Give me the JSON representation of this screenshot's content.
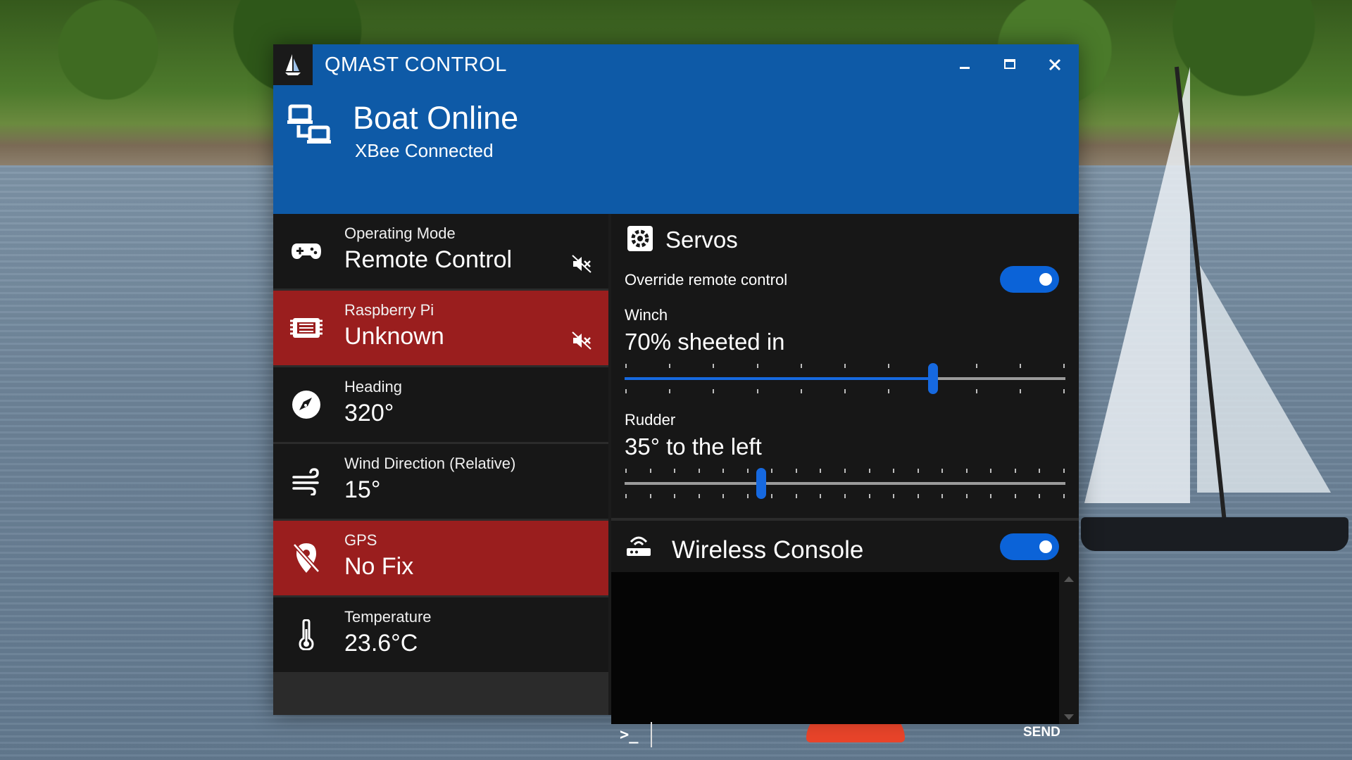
{
  "window": {
    "title": "QMAST CONTROL",
    "controls": {
      "minimize": "minimize-icon",
      "maximize": "maximize-icon",
      "close": "close-icon"
    }
  },
  "status": {
    "title": "Boat Online",
    "subtitle": "XBee Connected",
    "icon": "network-icon"
  },
  "tiles": [
    {
      "label": "Operating Mode",
      "value": "Remote Control",
      "icon": "gamepad-icon",
      "alert": false,
      "muted": true
    },
    {
      "label": "Raspberry Pi",
      "value": "Unknown",
      "icon": "chip-icon",
      "alert": true,
      "muted": true
    },
    {
      "label": "Heading",
      "value": "320°",
      "icon": "compass-icon",
      "alert": false,
      "muted": false
    },
    {
      "label": "Wind Direction (Relative)",
      "value": "15°",
      "icon": "wind-icon",
      "alert": false,
      "muted": false
    },
    {
      "label": "GPS",
      "value": "No Fix",
      "icon": "location-off-icon",
      "alert": true,
      "muted": false
    },
    {
      "label": "Temperature",
      "value": "23.6°C",
      "icon": "thermometer-icon",
      "alert": false,
      "muted": false
    }
  ],
  "servos": {
    "title": "Servos",
    "override_label": "Override remote control",
    "override_on": true,
    "winch": {
      "label": "Winch",
      "value_text": "70% sheeted in",
      "fraction": 0.7
    },
    "rudder": {
      "label": "Rudder",
      "value_text": "35° to the left",
      "fraction": 0.31
    }
  },
  "console": {
    "title": "Wireless Console",
    "enabled": true,
    "input_value": "",
    "send_label": "SEND"
  },
  "colors": {
    "accent": "#0e5aa7",
    "alert": "#9a1e1e",
    "toggle": "#0b63d8",
    "slider": "#1669e0"
  }
}
